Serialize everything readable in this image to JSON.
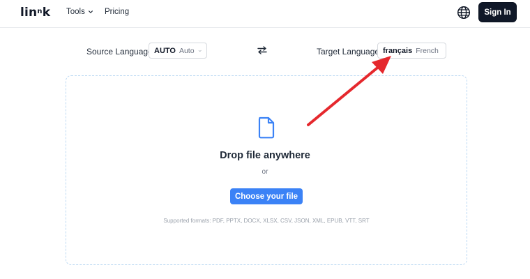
{
  "header": {
    "logo": {
      "text": "lin",
      "superscript": "n",
      "tail": "k"
    },
    "nav": [
      {
        "label": "Tools",
        "has_dropdown": true
      },
      {
        "label": "Pricing",
        "has_dropdown": false
      }
    ],
    "language_icon": "globe-icon",
    "sign_in_label": "Sign In"
  },
  "language_bar": {
    "source": {
      "label": "Source Language",
      "code": "AUTO",
      "name": "Auto"
    },
    "swap_icon": "swap-arrows-icon",
    "target": {
      "label": "Target Language",
      "code": "français",
      "name": "French"
    }
  },
  "dropzone": {
    "icon": "file-icon",
    "title": "Drop file anywhere",
    "separator": "or",
    "button_label": "Choose your file",
    "formats": "Supported formats: PDF, PPTX, DOCX, XLSX, CSV, JSON, XML, EPUB, VTT, SRT"
  },
  "annotation": {
    "type": "red-arrow",
    "color": "#e5282d"
  },
  "colors": {
    "primary_dark": "#101828",
    "accent_blue": "#3b82f6",
    "dropzone_border": "#bcd9f3",
    "annotation_red": "#e5282d"
  }
}
